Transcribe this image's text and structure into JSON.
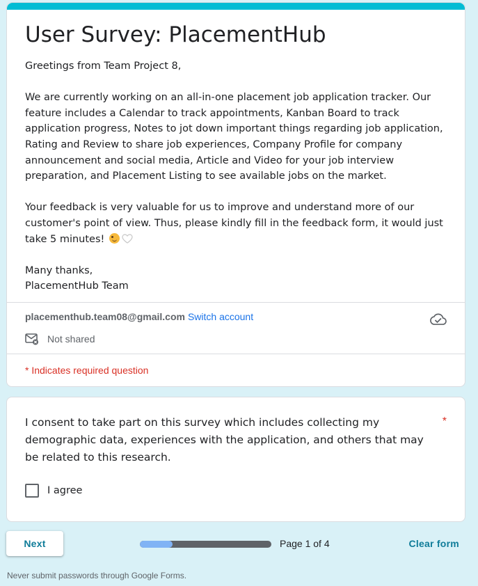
{
  "colors": {
    "accent_stripe": "#00bcd4",
    "page_background": "#d9f1f7",
    "link": "#1a73e8",
    "required": "#d93025",
    "button_text": "#0f7c99"
  },
  "form": {
    "title": "User Survey: PlacementHub",
    "description": {
      "greeting": "Greetings from Team Project 8,",
      "para1": "We are currently working on an all-in-one placement job application tracker. Our feature includes a Calendar to track appointments, Kanban Board to track application progress, Notes to jot down important things regarding job application, Rating and Review to share job experiences, Company Profile for company announcement and social media, Article and Video for your job interview preparation, and Placement Listing to see available jobs on the market.",
      "para2": "Your feedback is very valuable for us to improve and understand more of our customer's point of view. Thus, please kindly fill in the feedback form, it would just take 5 minutes!",
      "closing": "Many thanks,",
      "signature": "PlacementHub Team"
    },
    "account": {
      "email": "placementhub.team08@gmail.com",
      "switch_label": "Switch account",
      "shared_status": "Not shared",
      "cloud_icon": "cloud-check-icon",
      "mail_icon": "mail-not-shared-icon"
    },
    "required_note": "* Indicates required question"
  },
  "question": {
    "text": "I consent to take part on this survey which includes collecting my demographic data, experiences with the application, and others that may be related to this research.",
    "required_marker": "*",
    "option_label": "I agree",
    "checked": false
  },
  "footer": {
    "next_label": "Next",
    "progress": 0.25,
    "page_label": "Page 1 of 4",
    "clear_label": "Clear form",
    "note": "Never submit passwords through Google Forms."
  }
}
